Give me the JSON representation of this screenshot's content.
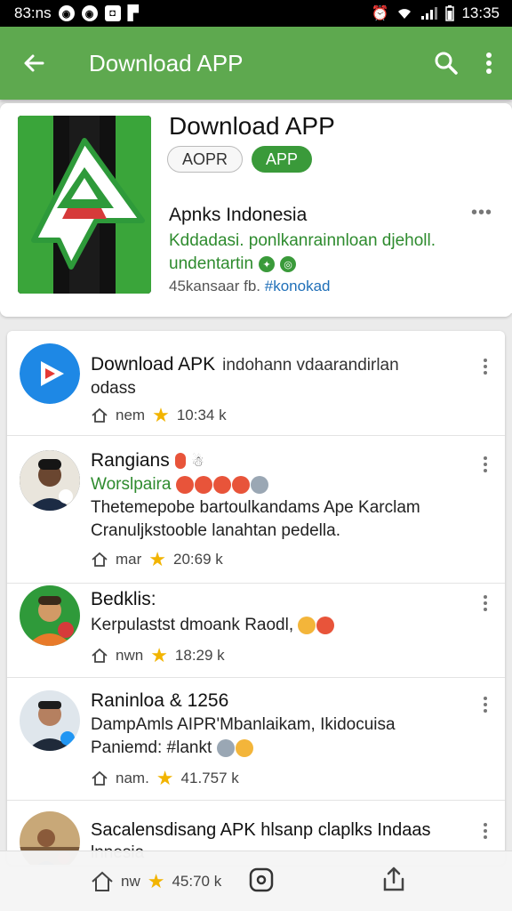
{
  "status_bar": {
    "left_time": "83:ns",
    "right_time": "13:35",
    "left_icons": [
      "whatsapp-icon",
      "whatsapp-icon",
      "camera-icon",
      "app-icon"
    ],
    "right_icons": [
      "alarm-icon",
      "wifi-icon",
      "signal-icon",
      "battery-icon"
    ]
  },
  "app_bar": {
    "title": "Download APP",
    "colors": {
      "background": "#5ea94f"
    }
  },
  "hero": {
    "title": "Download APP",
    "chip_outline": "AOPR",
    "chip_filled": "APP",
    "sub_name": "Apnks Indonesia",
    "sub_desc_1": "Kddadasi. ponlkanrainnloan djeholl.",
    "sub_desc_2": "undentartin",
    "sub_meta_prefix": "45kansaar fb.",
    "sub_meta_tag": "#konokad"
  },
  "feed": {
    "items": [
      {
        "title": "Download APK",
        "aside": "indohann vdaarandirlan",
        "line1": "odass",
        "meta_label": "nem",
        "meta_value": "10:34 k"
      },
      {
        "title": "Rangians",
        "title_suffix": "☃",
        "line1": "Worslpaira",
        "line2": "Thetemepobe bartoulkandams Ape Karclam",
        "line3": "Cranuljkstooble lanahtan pedella.",
        "meta_label": "mar",
        "meta_value": "20:69 k"
      },
      {
        "title": "Bedklis:",
        "line1": "Kerpulastst dmoank Raodl,",
        "meta_label": "nwn",
        "meta_value": "18:29 k"
      },
      {
        "title": "Raninloa & 1256",
        "line1": "DampAmls AIPR'Mbanlaikam, Ikidocuisa",
        "line2": "Paniemd: #lankt",
        "meta_label": "nam.",
        "meta_value": "41.757 k"
      },
      {
        "title": "Sacalensdisang APK hlsanp claplks Indaas",
        "line1": "lnnesia"
      }
    ]
  },
  "bottom_bar": {
    "meta_label": "nw",
    "meta_value": "45:70 k"
  }
}
